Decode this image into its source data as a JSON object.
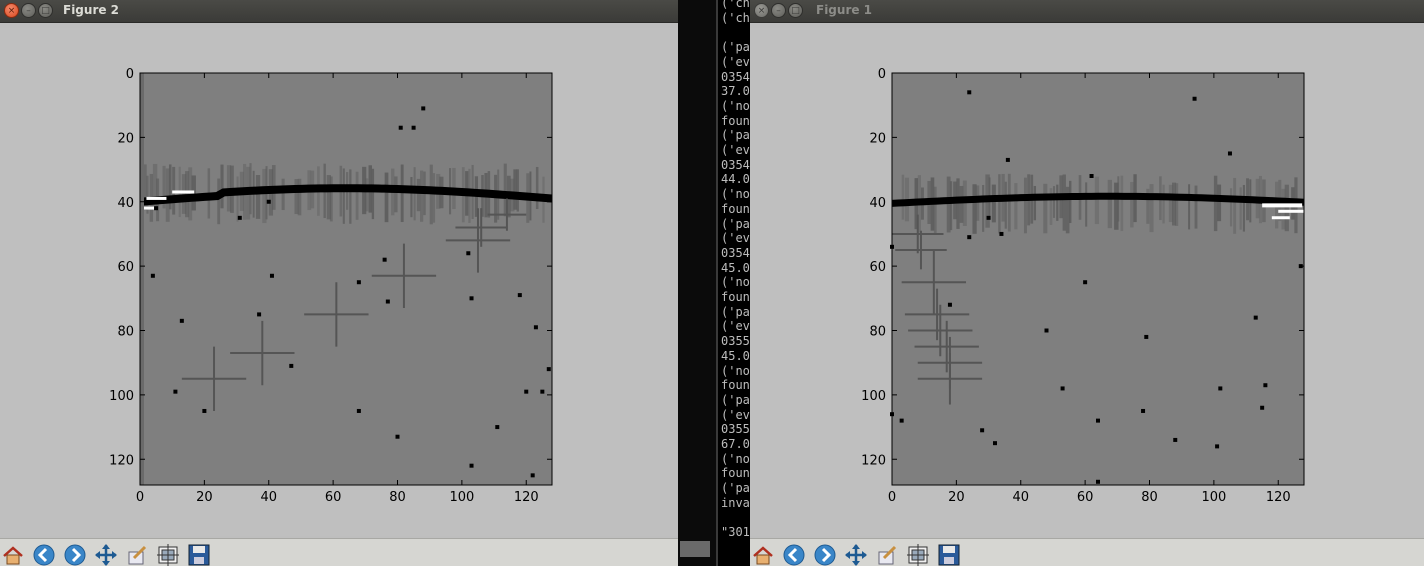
{
  "figure2": {
    "title": "Figure 2",
    "xticks": [
      "0",
      "20",
      "40",
      "60",
      "80",
      "100",
      "120"
    ],
    "yticks": [
      "0",
      "20",
      "40",
      "60",
      "80",
      "100",
      "120"
    ],
    "toolbar": [
      "home-icon",
      "back-icon",
      "forward-icon",
      "pan-icon",
      "zoom-icon",
      "subplots-icon",
      "save-icon"
    ]
  },
  "figure1": {
    "title": "Figure 1",
    "xticks": [
      "0",
      "20",
      "40",
      "60",
      "80",
      "100",
      "120"
    ],
    "yticks": [
      "0",
      "20",
      "40",
      "60",
      "80",
      "100",
      "120"
    ],
    "toolbar": [
      "home-icon",
      "back-icon",
      "forward-icon",
      "pan-icon",
      "zoom-icon",
      "subplots-icon",
      "save-icon"
    ]
  },
  "terminal": {
    "lines": [
      "('ch",
      "('ch",
      "",
      "('pa",
      "('ev",
      "0354",
      "37.0",
      "('no",
      "foun",
      "('pa",
      "('ev",
      "0354",
      "44.0",
      "('no",
      "foun",
      "('pa",
      "('ev",
      "0354",
      "45.0",
      "('no",
      "foun",
      "('pa",
      "('ev",
      "0355",
      "45.0",
      "('no",
      "foun",
      "('pa",
      "('ev",
      "0355",
      "67.0",
      "('no",
      "foun",
      "('pa",
      "inva",
      "",
      "\"301"
    ]
  },
  "colors": {
    "image_bg": "#7f7f7f",
    "stripe": "#5a5a5a",
    "curve": "#000000",
    "highlight": "#ffffff"
  }
}
